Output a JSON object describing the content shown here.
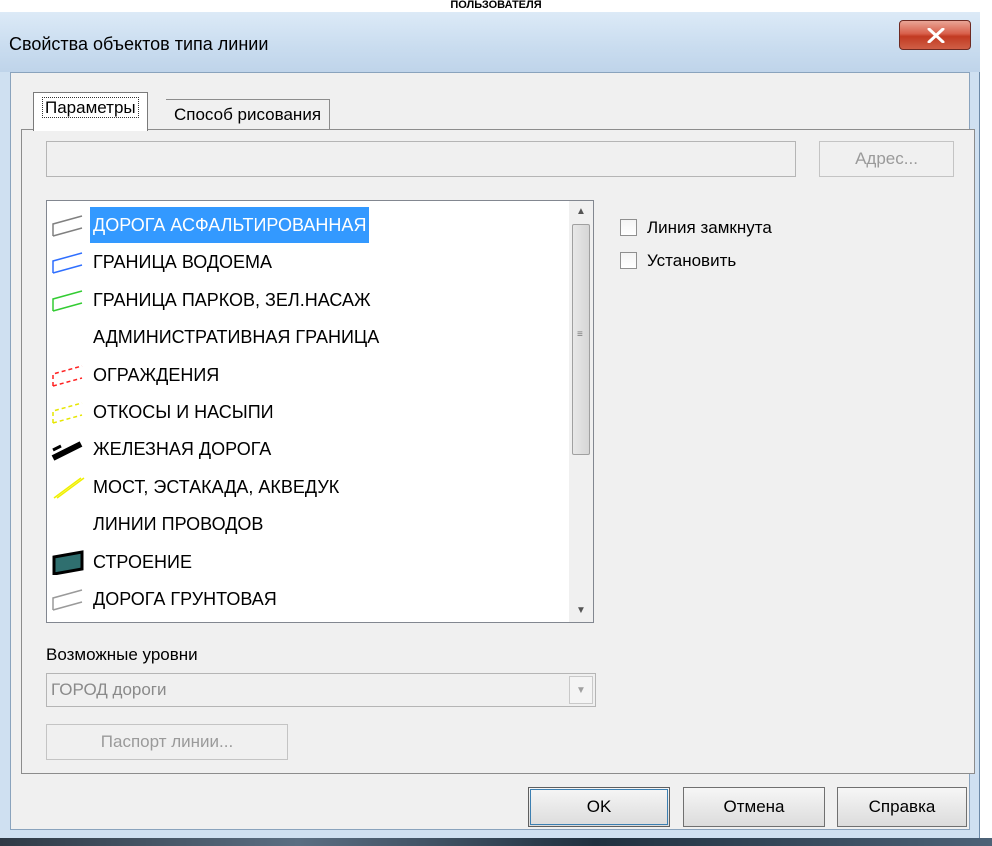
{
  "top_caption": "ПОЛЬЗОВАТЕЛЯ",
  "window": {
    "title": "Свойства объектов типа линии",
    "close_glyph": "X"
  },
  "tabs": [
    {
      "label": "Параметры",
      "active": true
    },
    {
      "label": "Способ рисования",
      "active": false
    }
  ],
  "address": {
    "value": "",
    "button_label": "Адрес...",
    "button_enabled": false
  },
  "line_types": {
    "selected_index": 0,
    "items": [
      {
        "label": "ДОРОГА АСФАЛЬТИРОВАННАЯ",
        "icon": "asphalt-road-icon",
        "color": "#808080"
      },
      {
        "label": "ГРАНИЦА ВОДОЕМА",
        "icon": "water-boundary-icon",
        "color": "#2f6fff"
      },
      {
        "label": "ГРАНИЦА ПАРКОВ, ЗЕЛ.НАСАЖ",
        "icon": "park-boundary-icon",
        "color": "#33cc33"
      },
      {
        "label": "АДМИНИСТРАТИВНАЯ ГРАНИЦА",
        "icon": "admin-boundary-icon",
        "color": "#ffffff"
      },
      {
        "label": "ОГРАЖДЕНИЯ",
        "icon": "fence-icon",
        "color": "#ff2020"
      },
      {
        "label": "ОТКОСЫ И НАСЫПИ",
        "icon": "slope-icon",
        "color": "#e6e600"
      },
      {
        "label": "ЖЕЛЕЗНАЯ ДОРОГА",
        "icon": "railway-icon",
        "color": "#000000"
      },
      {
        "label": "МОСТ, ЭСТАКАДА, АКВЕДУК",
        "icon": "bridge-icon",
        "color": "#f0f000"
      },
      {
        "label": "ЛИНИИ ПРОВОДОВ",
        "icon": "wires-icon",
        "color": "#ffffff"
      },
      {
        "label": "СТРОЕНИЕ",
        "icon": "building-icon",
        "color": "#2f6f6f"
      },
      {
        "label": "ДОРОГА ГРУНТОВАЯ",
        "icon": "dirt-road-icon",
        "color": "#9a9a9a"
      }
    ]
  },
  "options": {
    "closed_line_label": "Линия замкнута",
    "closed_line_checked": false,
    "set_label": "Установить",
    "set_checked": false
  },
  "levels": {
    "label": "Возможные уровни",
    "selected": "ГОРОД дороги",
    "enabled": false
  },
  "passport_button": "Паспорт линии...",
  "footer": {
    "ok": "OK",
    "cancel": "Отмена",
    "help": "Справка"
  },
  "colors": {
    "selection": "#3399ff",
    "titlebar": "#cfe0f1",
    "close_button": "#c94a33"
  }
}
